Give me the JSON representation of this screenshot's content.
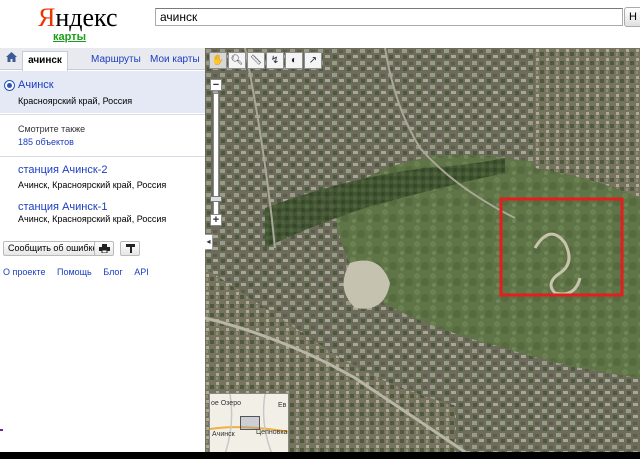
{
  "header": {
    "logo_first": "Я",
    "logo_rest": "ндекс",
    "service": "карты",
    "search_value": "ачинск",
    "search_button": "Н"
  },
  "tabs": {
    "active": "ачинск",
    "routes": "Маршруты",
    "my_maps": "Мои карты"
  },
  "result": {
    "title": "Ачинск",
    "subtitle": "Красноярский край, Россия"
  },
  "see_also": {
    "label": "Смотрите также",
    "count": "185 объектов"
  },
  "stations": [
    {
      "title": "станция Ачинск-2",
      "subtitle": "Ачинск, Красноярский край, Россия"
    },
    {
      "title": "станция Ачинск-1",
      "subtitle": "Ачинск, Красноярский край, Россия"
    }
  ],
  "actions": {
    "report": "Сообщить об ошибке"
  },
  "footer": {
    "about": "О проекте",
    "help": "Помощь",
    "blog": "Блог",
    "api": "API"
  },
  "map": {
    "minimap_label_1": "ое Озеро",
    "minimap_label_2": "Ачинск",
    "minimap_label_3": "Цепновка",
    "minimap_label_4": "Ев",
    "highlight_color": "#e31e1e"
  },
  "icons": {
    "home": "home-icon",
    "hand": "hand-icon",
    "magnifier": "magnifier-icon",
    "ruler": "ruler-icon",
    "print": "printer-icon",
    "flag": "flag-icon"
  }
}
